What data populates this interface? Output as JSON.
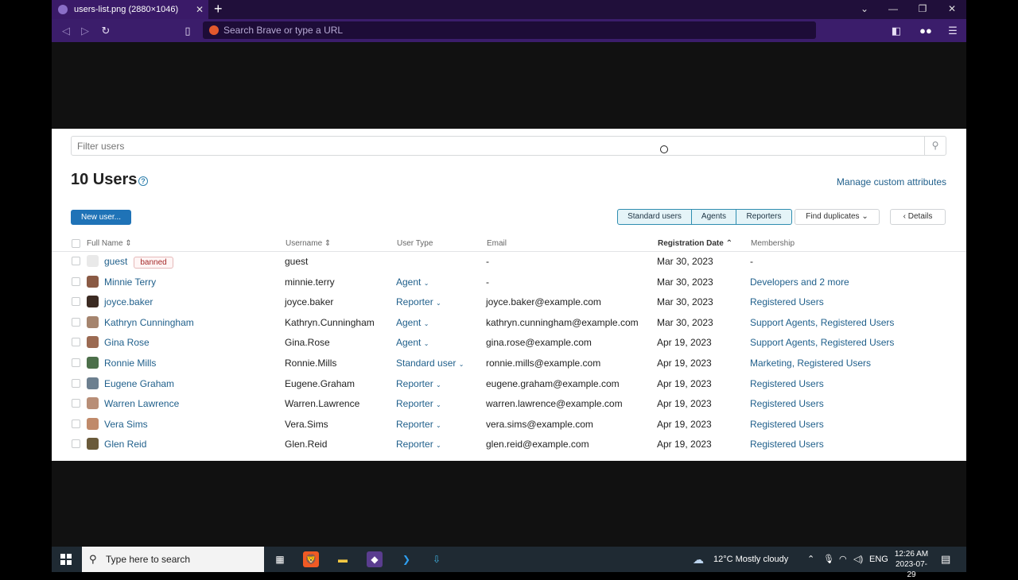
{
  "browser": {
    "tab_title": "users-list.png (2880×1046)",
    "tab_close": "✕",
    "new_tab": "+",
    "url_placeholder": "Search Brave or type a URL"
  },
  "page": {
    "filter_placeholder": "Filter users",
    "title": "10 Users",
    "help_icon": "?",
    "manage_link": "Manage custom attributes",
    "new_user_button": "New user...",
    "segments": [
      "Standard users",
      "Agents",
      "Reporters"
    ],
    "find_duplicates": "Find duplicates ⌄",
    "details": "‹  Details",
    "columns": {
      "full_name": "Full Name ⇕",
      "username": "Username ⇕",
      "user_type": "User Type",
      "email": "Email",
      "registration_date": "Registration Date ⌃",
      "membership": "Membership"
    },
    "users": [
      {
        "name": "guest",
        "badge": "banned",
        "username": "guest",
        "type": "",
        "email": "-",
        "date": "Mar 30, 2023",
        "membership": "-",
        "membership_link": false
      },
      {
        "name": "Minnie Terry",
        "badge": "",
        "username": "minnie.terry",
        "type": "Agent",
        "email": "-",
        "date": "Mar 30, 2023",
        "membership": "Developers and 2 more",
        "membership_link": true
      },
      {
        "name": "joyce.baker",
        "badge": "",
        "username": "joyce.baker",
        "type": "Reporter",
        "email": "joyce.baker@example.com",
        "date": "Mar 30, 2023",
        "membership": "Registered Users",
        "membership_link": true
      },
      {
        "name": "Kathryn Cunningham",
        "badge": "",
        "username": "Kathryn.Cunningham",
        "type": "Agent",
        "email": "kathryn.cunningham@example.com",
        "date": "Mar 30, 2023",
        "membership": "Support Agents, Registered Users",
        "membership_link": true
      },
      {
        "name": "Gina Rose",
        "badge": "",
        "username": "Gina.Rose",
        "type": "Agent",
        "email": "gina.rose@example.com",
        "date": "Apr 19, 2023",
        "membership": "Support Agents, Registered Users",
        "membership_link": true
      },
      {
        "name": "Ronnie Mills",
        "badge": "",
        "username": "Ronnie.Mills",
        "type": "Standard user",
        "email": "ronnie.mills@example.com",
        "date": "Apr 19, 2023",
        "membership": "Marketing, Registered Users",
        "membership_link": true
      },
      {
        "name": "Eugene Graham",
        "badge": "",
        "username": "Eugene.Graham",
        "type": "Reporter",
        "email": "eugene.graham@example.com",
        "date": "Apr 19, 2023",
        "membership": "Registered Users",
        "membership_link": true
      },
      {
        "name": "Warren Lawrence",
        "badge": "",
        "username": "Warren.Lawrence",
        "type": "Reporter",
        "email": "warren.lawrence@example.com",
        "date": "Apr 19, 2023",
        "membership": "Registered Users",
        "membership_link": true
      },
      {
        "name": "Vera Sims",
        "badge": "",
        "username": "Vera.Sims",
        "type": "Reporter",
        "email": "vera.sims@example.com",
        "date": "Apr 19, 2023",
        "membership": "Registered Users",
        "membership_link": true
      },
      {
        "name": "Glen Reid",
        "badge": "",
        "username": "Glen.Reid",
        "type": "Reporter",
        "email": "glen.reid@example.com",
        "date": "Apr 19, 2023",
        "membership": "Registered Users",
        "membership_link": true
      }
    ]
  },
  "taskbar": {
    "search_placeholder": "Type here to search",
    "weather": "12°C  Mostly cloudy",
    "lang": "ENG",
    "time": "12:26 AM",
    "date": "2023-07-29"
  },
  "colors": {
    "brand_blue": "#1f73b7",
    "link": "#1f5f8b",
    "browser_purple": "#3b1d6b"
  }
}
